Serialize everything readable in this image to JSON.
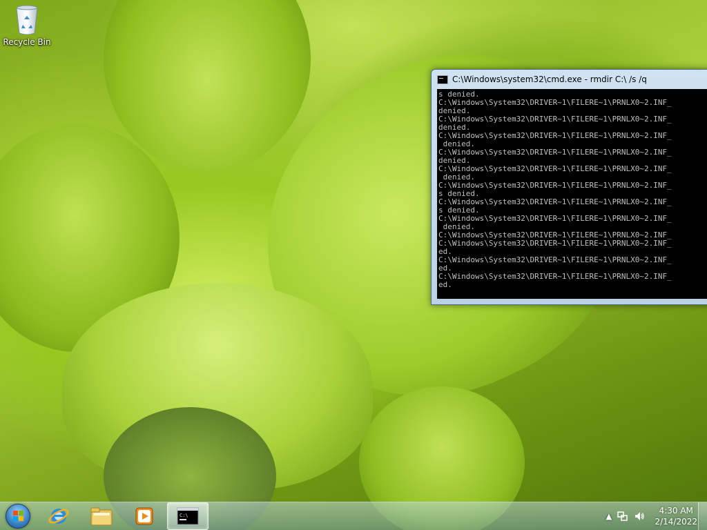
{
  "desktop": {
    "icons": [
      {
        "label": "Recycle Bin",
        "icon": "recycle-bin-icon"
      }
    ]
  },
  "cmd_window": {
    "title": "C:\\Windows\\system32\\cmd.exe - rmdir  C:\\ /s /q",
    "lines": [
      "s denied.",
      "C:\\Windows\\System32\\DRIVER~1\\FILERE~1\\PRNLX0~2.INF_",
      "denied.",
      "C:\\Windows\\System32\\DRIVER~1\\FILERE~1\\PRNLX0~2.INF_",
      "denied.",
      "C:\\Windows\\System32\\DRIVER~1\\FILERE~1\\PRNLX0~2.INF_",
      " denied.",
      "C:\\Windows\\System32\\DRIVER~1\\FILERE~1\\PRNLX0~2.INF_",
      "denied.",
      "C:\\Windows\\System32\\DRIVER~1\\FILERE~1\\PRNLX0~2.INF_",
      " denied.",
      "C:\\Windows\\System32\\DRIVER~1\\FILERE~1\\PRNLX0~2.INF_",
      "s denied.",
      "C:\\Windows\\System32\\DRIVER~1\\FILERE~1\\PRNLX0~2.INF_",
      "s denied.",
      "C:\\Windows\\System32\\DRIVER~1\\FILERE~1\\PRNLX0~2.INF_",
      " denied.",
      "C:\\Windows\\System32\\DRIVER~1\\FILERE~1\\PRNLX0~2.INF_",
      "C:\\Windows\\System32\\DRIVER~1\\FILERE~1\\PRNLX0~2.INF_",
      "ed.",
      "C:\\Windows\\System32\\DRIVER~1\\FILERE~1\\PRNLX0~2.INF_",
      "ed.",
      "C:\\Windows\\System32\\DRIVER~1\\FILERE~1\\PRNLX0~2.INF_",
      "ed."
    ]
  },
  "taskbar": {
    "start_icon": "windows-start-orb-icon",
    "pinned": [
      {
        "name": "internet-explorer",
        "icon": "internet-explorer-icon"
      },
      {
        "name": "windows-explorer",
        "icon": "folder-icon"
      },
      {
        "name": "media-player",
        "icon": "media-player-icon"
      },
      {
        "name": "command-prompt",
        "icon": "command-prompt-icon",
        "active": true
      }
    ],
    "tray": {
      "show_hidden_glyph": "▲",
      "clock_time": "4:30 AM",
      "clock_date": "2/14/2022"
    }
  },
  "colors": {
    "terminal_bg": "#000000",
    "terminal_fg": "#c0c0c0"
  }
}
